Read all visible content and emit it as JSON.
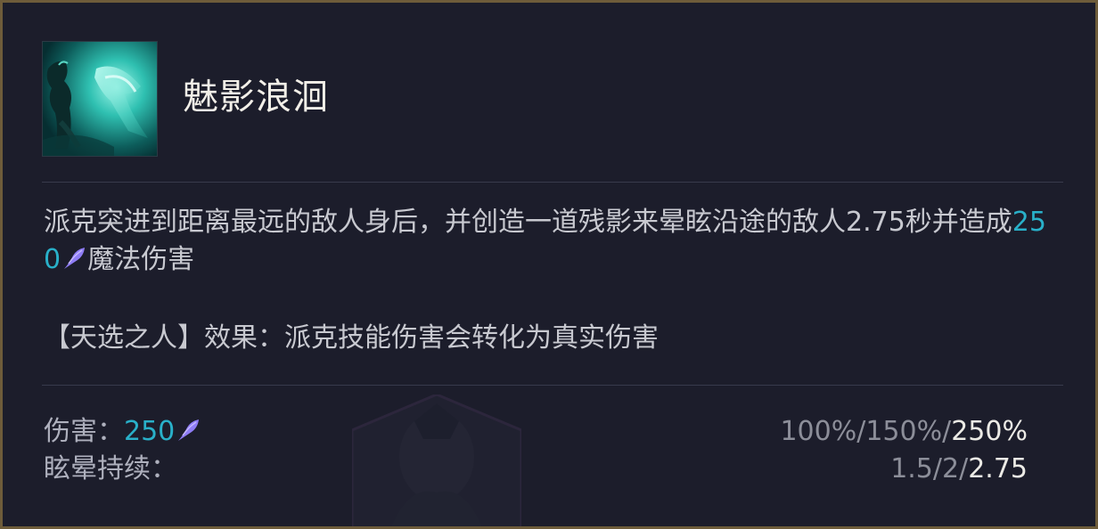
{
  "ability": {
    "name": "魅影浪洄",
    "icon": "pyke-phantom-undertow-ability-icon"
  },
  "description": {
    "text_before": "派克突进到距离最远的敌人身后，并创造一道残影来晕眩沿途的敌人2.75秒并造成",
    "damage_value": "250",
    "damage_icon": "ability-power-icon",
    "text_after": "魔法伤害"
  },
  "chosen_effect": {
    "text": "【天选之人】效果：派克技能伤害会转化为真实伤害"
  },
  "stats": {
    "damage": {
      "label": "伤害：",
      "value": "250",
      "icon": "ability-power-icon",
      "scaling_dim": "100%/150%/",
      "scaling_highlight": "250%"
    },
    "stun": {
      "label": "眩晕持续：",
      "scaling_dim": "1.5/2/",
      "scaling_highlight": "2.75"
    }
  },
  "colors": {
    "border": "#6e5c3a",
    "background": "#1c1d2b",
    "magic_damage": "#29b0c9",
    "ap_icon": "#8e7cf5",
    "title": "#f2efe8",
    "body_text": "#c8c9d0"
  }
}
